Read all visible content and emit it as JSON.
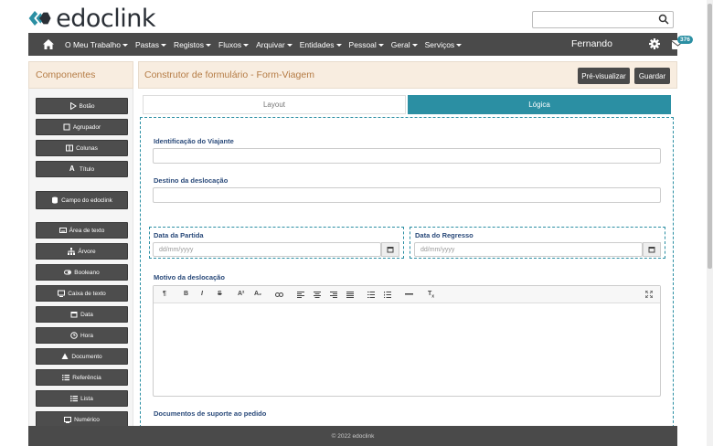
{
  "brand": {
    "name": "edoclink",
    "accent": "#2b8fa3",
    "dark": "#4a4a4a",
    "header_bg": "#f8ede0",
    "header_text": "#b57c45"
  },
  "search": {
    "placeholder": "",
    "icon": "search-icon"
  },
  "nav": {
    "home_icon": "home-icon",
    "items": [
      "O Meu Trabalho",
      "Pastas",
      "Registos",
      "Fluxos",
      "Arquivar",
      "Entidades",
      "Pessoal",
      "Geral",
      "Serviços"
    ],
    "user": "Fernando",
    "settings_icon": "gear-icon",
    "mail_icon": "envelope-icon",
    "mail_count": "376"
  },
  "left_panel": {
    "title": "Componentes",
    "components": [
      {
        "label": "Botão",
        "icon": "play-icon"
      },
      {
        "label": "Agrupador",
        "icon": "square-icon"
      },
      {
        "label": "Colunas",
        "icon": "columns-icon"
      },
      {
        "label": "Título",
        "icon": "font-icon"
      },
      {
        "label": "Campo do edoclink",
        "icon": "database-icon"
      },
      {
        "label": "Área de texto",
        "icon": "keyboard-icon"
      },
      {
        "label": "Árvore",
        "icon": "sitemap-icon"
      },
      {
        "label": "Booleano",
        "icon": "toggle-icon"
      },
      {
        "label": "Caixa de texto",
        "icon": "textbox-icon"
      },
      {
        "label": "Data",
        "icon": "calendar-icon"
      },
      {
        "label": "Hora",
        "icon": "clock-icon"
      },
      {
        "label": "Documento",
        "icon": "document-icon"
      },
      {
        "label": "Referência",
        "icon": "list-icon"
      },
      {
        "label": "Lista",
        "icon": "list-ul-icon"
      },
      {
        "label": "Numérico",
        "icon": "numeric-icon"
      }
    ]
  },
  "main": {
    "title": "Construtor de formulário - Form-Viagem",
    "preview_button": "Pré-visualizar",
    "save_button": "Guardar",
    "tabs": [
      {
        "label": "Layout",
        "active": false
      },
      {
        "label": "Lógica",
        "active": true
      }
    ],
    "fields": {
      "traveler_label": "Identificação do Viajante",
      "destination_label": "Destino da deslocação",
      "departure_label": "Data da Partida",
      "departure_placeholder": "dd/mm/yyyy",
      "return_label": "Data do Regresso",
      "return_placeholder": "dd/mm/yyyy",
      "reason_label": "Motivo da deslocação",
      "docs_label": "Documentos de suporte ao pedido"
    },
    "editor_toolbar": [
      "¶",
      "B",
      "I",
      "S",
      "A²",
      "A₂",
      "link",
      "align-left",
      "align-center",
      "align-right",
      "align-justify",
      "list-ul",
      "list-ol",
      "hr",
      "clear-format",
      "fullscreen"
    ]
  },
  "footer": {
    "text": "© 2022 edoclink"
  }
}
